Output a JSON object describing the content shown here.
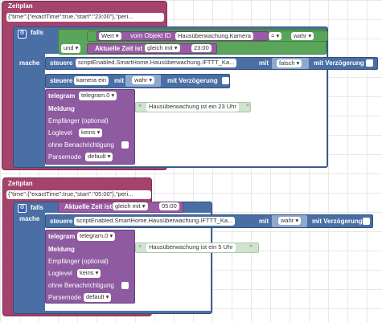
{
  "block1": {
    "title": "Zeitplan",
    "schedule": "{\"time\":{\"exactTime\":true,\"start\":\"23:00\"},\"peri...",
    "if_label": "falls",
    "do_label": "mache",
    "und": "und",
    "wert": "Wert",
    "vom_objekt": "vom Objekt ID",
    "object_id": "Hausüberwachung.Kamera",
    "eq": "=",
    "wahr": "wahr",
    "aktuelle_zeit": "Aktuelle Zeit ist",
    "gleich_mit": "gleich mit",
    "time_value": "23:00",
    "steuere1": "steuere",
    "steuere1_target": "scriptEnabled.SmartHome.Hausüberwachung.IFTTT_Ka...",
    "mit1": "mit",
    "value1": "falsch",
    "delay1": "mit Verzögerung",
    "steuere2": "steuere",
    "steuere2_target": "kamera ein",
    "mit2": "mit",
    "value2": "wahr",
    "delay2": "mit Verzögerung",
    "telegram": "telegram",
    "telegram_instance": "telegram.0",
    "meldung": "Meldung",
    "message": "Hausüberwachung ist ein 23 Uhr",
    "empfaenger": "Empfänger (optional)",
    "loglevel": "Loglevel",
    "loglevel_value": "keins",
    "ohne_benachrichtigung": "ohne Benachrichtigung",
    "parsemode": "Parsemode",
    "parsemode_value": "default"
  },
  "block2": {
    "title": "Zeitplan",
    "schedule": "{\"time\":{\"exactTime\":true,\"start\":\"05:00\"},\"peri...",
    "if_label": "falls",
    "do_label": "mache",
    "aktuelle_zeit": "Aktuelle Zeit ist",
    "gleich_mit": "gleich mit",
    "time_value": "05:00",
    "steuere": "steuere",
    "steuere_target": "scriptEnabled.SmartHome.Hausüberwachung.IFTTT_Ka...",
    "mit": "mit",
    "value": "wahr",
    "delay": "mit Verzögerung",
    "telegram": "telegram",
    "telegram_instance": "telegram.0",
    "meldung": "Meldung",
    "message": "Hausüberwachung ist ein 5 Uhr",
    "empfaenger": "Empfänger (optional)",
    "loglevel": "Loglevel",
    "loglevel_value": "keins",
    "ohne_benachrichtigung": "ohne Benachrichtigung",
    "parsemode": "Parsemode",
    "parsemode_value": "default"
  },
  "colors": {
    "schedule_block": "#a5436d",
    "if_block": "#4a6fa5",
    "logic_block": "#5ba55b",
    "time_block": "#995ba5",
    "telegram_block": "#8e5aa0",
    "text_block": "#cfe3cf"
  }
}
